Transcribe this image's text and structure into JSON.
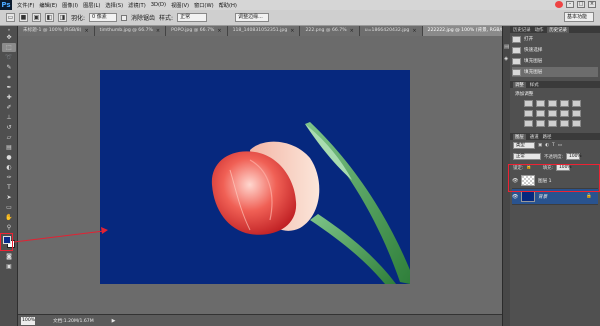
{
  "menubar": {
    "logo": "Ps",
    "items": [
      "文件(F)",
      "编辑(E)",
      "图像(I)",
      "图层(L)",
      "选择(S)",
      "滤镜(T)",
      "3D(D)",
      "视图(V)",
      "窗口(W)",
      "帮助(H)"
    ],
    "workspace": "基本功能"
  },
  "options_bar": {
    "feather_label": "羽化:",
    "feather_value": "0 像素",
    "antialias_label": "消除锯齿",
    "style_label": "样式:",
    "style_value": "正常",
    "refine_edge": "调整边缘..."
  },
  "tabs": [
    {
      "label": "未标题-1 @ 100% (RGB/8)",
      "active": false
    },
    {
      "label": "timthumb.jpg @ 66.7%",
      "active": false
    },
    {
      "label": "POPO.jpg @ 66.7%",
      "active": false
    },
    {
      "label": "118_140831052351.jpg",
      "active": false
    },
    {
      "label": "222.png @ 66.7%",
      "active": false
    },
    {
      "label": "u=1866420432.jpg",
      "active": false
    },
    {
      "label": "222222.jpg @ 100% (背景, RGB/8#)",
      "active": true
    }
  ],
  "status": {
    "zoom": "100%",
    "doc_info": "文档:1.20M/1.67M"
  },
  "history_panel": {
    "tabs": [
      "历史记录",
      "动作",
      "历史记录"
    ],
    "items": [
      {
        "label": "打开",
        "selected": false
      },
      {
        "label": "快速选择",
        "selected": false
      },
      {
        "label": "填充图层",
        "selected": false
      },
      {
        "label": "填充图层",
        "selected": true
      }
    ]
  },
  "adjustments_panel": {
    "tabs": [
      "调整",
      "样式"
    ],
    "label": "添加调整"
  },
  "layers_panel": {
    "tabs": [
      "图层",
      "通道",
      "路径"
    ],
    "kind": "类型",
    "blend_mode": "正常",
    "opacity_label": "不透明度:",
    "opacity": "100%",
    "lock_label": "锁定:",
    "fill_label": "填充:",
    "fill": "100%",
    "layers": [
      {
        "name": "图层 1",
        "selected": false
      },
      {
        "name": "背景",
        "selected": true
      }
    ]
  },
  "colors": {
    "foreground": "#0a2a8a",
    "background": "#ffffff",
    "canvas_bg": "#06287e",
    "annotation": "#e22233"
  }
}
